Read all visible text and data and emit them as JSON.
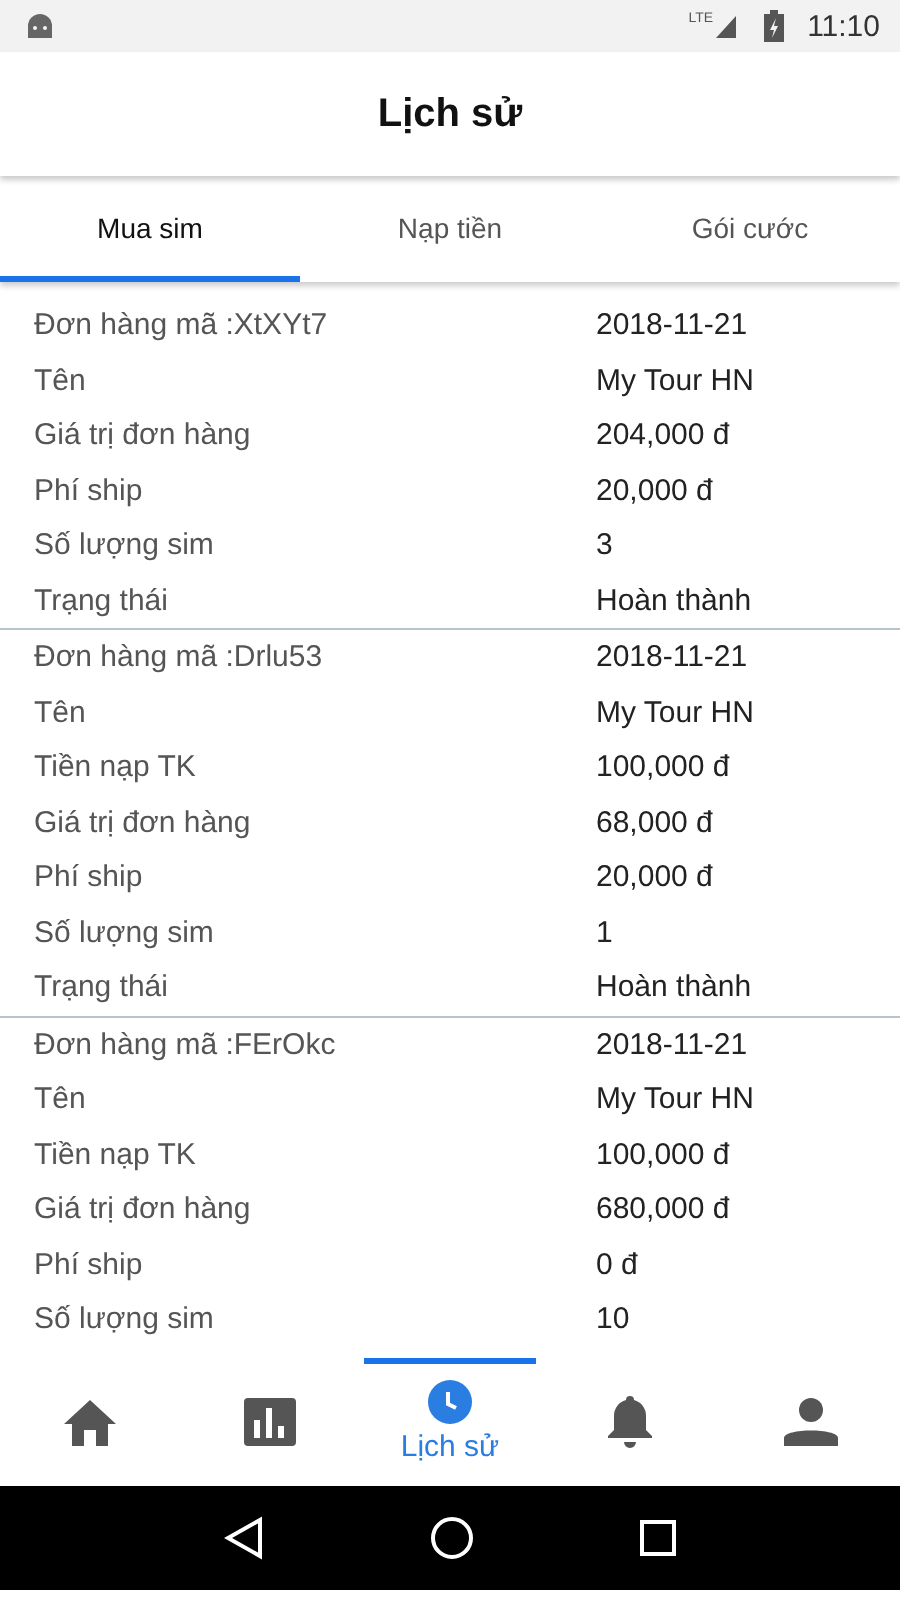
{
  "status_bar": {
    "network": "LTE",
    "time": "11:10"
  },
  "header": {
    "title": "Lịch sử"
  },
  "tabs": [
    {
      "label": "Mua sim",
      "selected": true
    },
    {
      "label": "Nạp tiền",
      "selected": false
    },
    {
      "label": "Gói cước",
      "selected": false
    }
  ],
  "orders": [
    {
      "rows": [
        {
          "label": "Đơn hàng mã :XtXYt7",
          "value": "2018-11-21"
        },
        {
          "label": "Tên",
          "value": "My Tour HN"
        },
        {
          "label": "Giá trị đơn hàng",
          "value": "204,000 đ"
        },
        {
          "label": "Phí ship",
          "value": "20,000 đ"
        },
        {
          "label": "Số lượng sim",
          "value": "3"
        },
        {
          "label": "Trạng thái",
          "value": "Hoàn thành"
        }
      ]
    },
    {
      "rows": [
        {
          "label": "Đơn hàng mã :Drlu53",
          "value": "2018-11-21"
        },
        {
          "label": "Tên",
          "value": "My Tour HN"
        },
        {
          "label": "Tiền nạp TK",
          "value": "100,000 đ"
        },
        {
          "label": "Giá trị đơn hàng",
          "value": "68,000 đ"
        },
        {
          "label": "Phí ship",
          "value": "20,000 đ"
        },
        {
          "label": "Số lượng sim",
          "value": "1"
        },
        {
          "label": "Trạng thái",
          "value": "Hoàn thành"
        }
      ]
    },
    {
      "rows": [
        {
          "label": "Đơn hàng mã :FErOkc",
          "value": "2018-11-21"
        },
        {
          "label": "Tên",
          "value": "My Tour HN"
        },
        {
          "label": "Tiền nạp TK",
          "value": "100,000 đ"
        },
        {
          "label": "Giá trị đơn hàng",
          "value": "680,000 đ"
        },
        {
          "label": "Phí ship",
          "value": "0 đ"
        },
        {
          "label": "Số lượng sim",
          "value": "10"
        }
      ]
    }
  ],
  "bottom_nav": [
    {
      "kind": "home",
      "selected": false
    },
    {
      "kind": "chart",
      "selected": false
    },
    {
      "kind": "clock",
      "selected": true,
      "label": "Lịch sử"
    },
    {
      "kind": "bell",
      "selected": false
    },
    {
      "kind": "person",
      "selected": false
    }
  ]
}
